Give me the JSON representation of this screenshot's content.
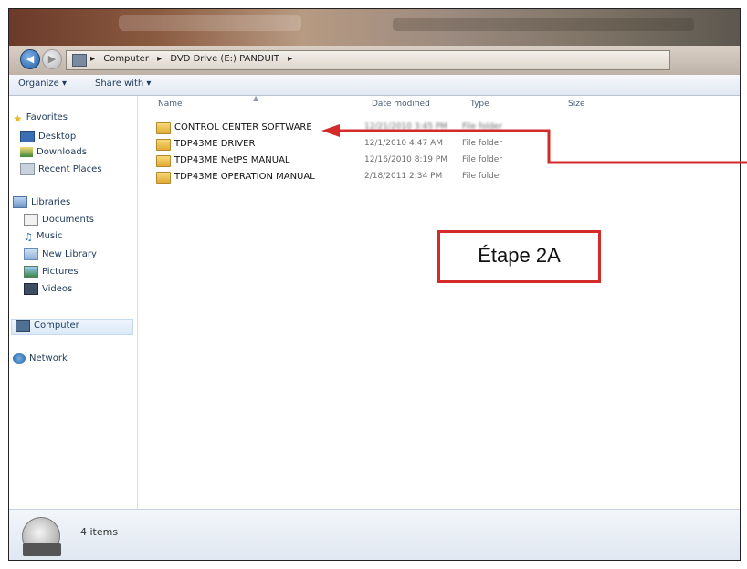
{
  "address": {
    "segments": [
      "Computer",
      "DVD Drive (E:) PANDUIT"
    ],
    "separator": "▸"
  },
  "toolbar": {
    "organize": "Organize ▾",
    "share": "Share with ▾"
  },
  "sidebar": {
    "favorites": {
      "label": "Favorites",
      "items": [
        "Desktop",
        "Downloads",
        "Recent Places"
      ]
    },
    "libraries": {
      "label": "Libraries",
      "items": [
        "Documents",
        "Music",
        "New Library",
        "Pictures",
        "Videos"
      ]
    },
    "computer": "Computer",
    "network": "Network"
  },
  "columns": {
    "name": "Name",
    "date": "Date modified",
    "type": "Type",
    "size": "Size"
  },
  "files": [
    {
      "name": "CONTROL CENTER SOFTWARE",
      "date": "12/21/2010 3:45 PM",
      "type": "File folder"
    },
    {
      "name": "TDP43ME DRIVER",
      "date": "12/1/2010 4:47 AM",
      "type": "File folder"
    },
    {
      "name": "TDP43ME NetPS MANUAL",
      "date": "12/16/2010 8:19 PM",
      "type": "File folder"
    },
    {
      "name": "TDP43ME OPERATION MANUAL",
      "date": "2/18/2011 2:34 PM",
      "type": "File folder"
    }
  ],
  "status": {
    "items_count": "4 items"
  },
  "annotation": {
    "label": "Étape 2A",
    "color": "#d42a2a"
  }
}
